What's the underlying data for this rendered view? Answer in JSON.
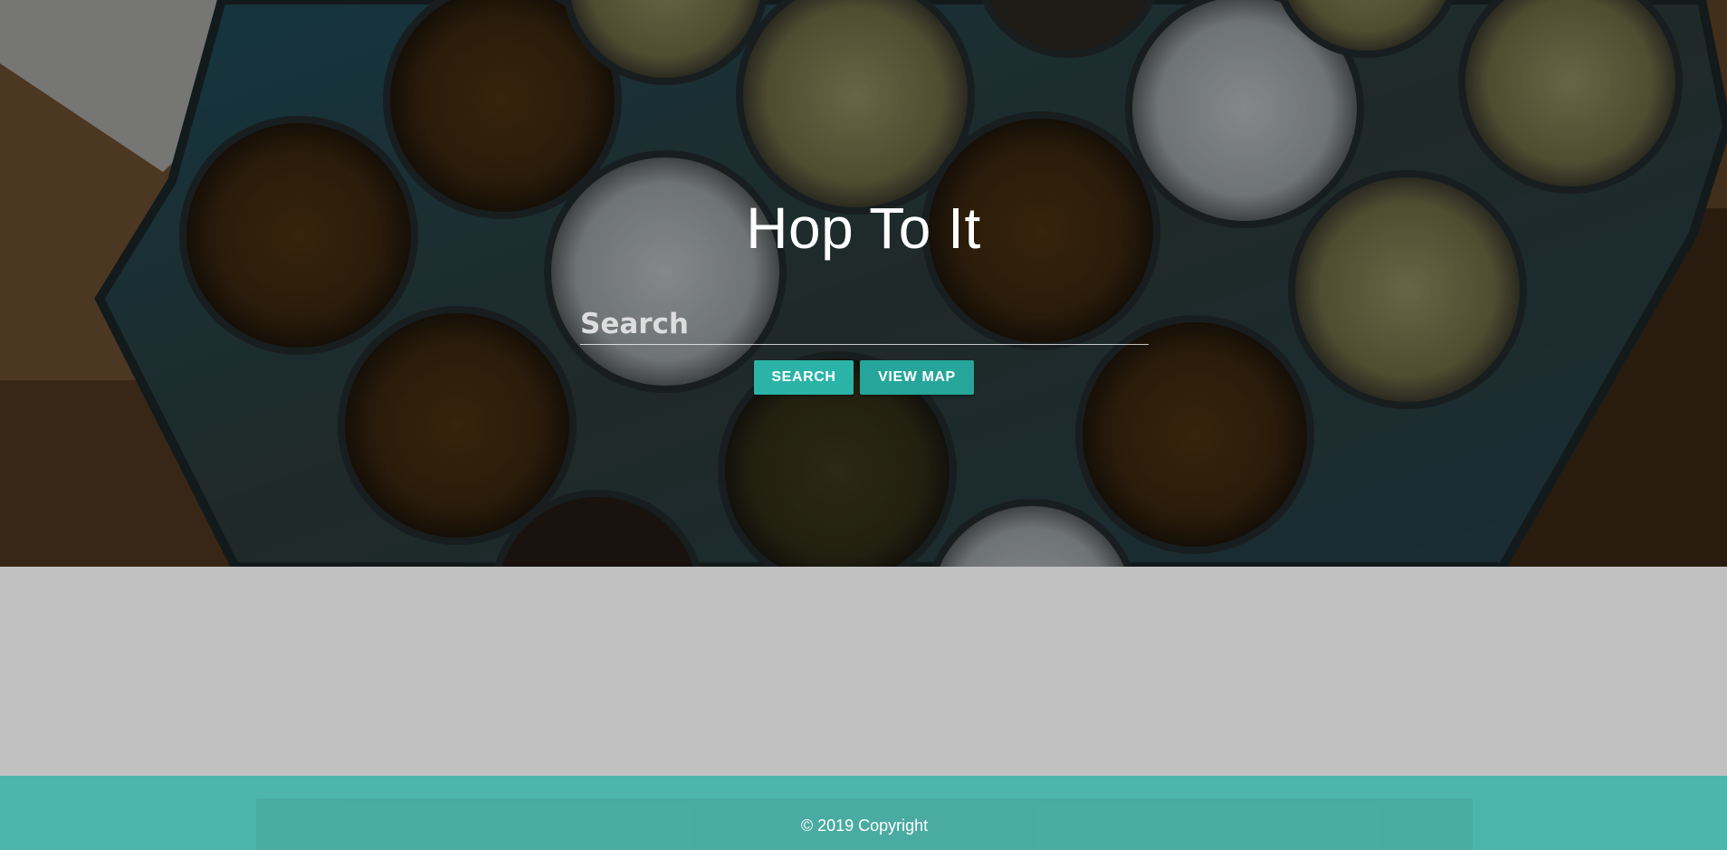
{
  "hero": {
    "title": "Hop To It"
  },
  "search": {
    "placeholder": "Search",
    "value": ""
  },
  "buttons": {
    "search_label": "Search",
    "map_label": "View Map"
  },
  "footer": {
    "copyright": "© 2019 Copyright"
  },
  "colors": {
    "accent": "#26a69a",
    "footer": "#4db6ac",
    "body_bg": "#c1c1c1"
  }
}
